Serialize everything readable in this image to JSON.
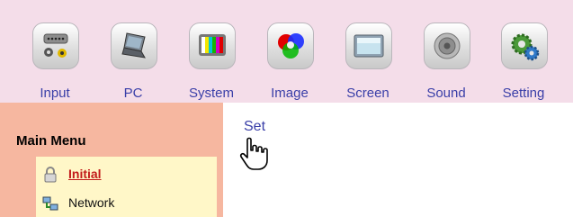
{
  "toolbar": {
    "items": [
      {
        "label": "Input",
        "icon": "input-connector-icon"
      },
      {
        "label": "PC",
        "icon": "laptop-icon"
      },
      {
        "label": "System",
        "icon": "color-bars-icon"
      },
      {
        "label": "Image",
        "icon": "rgb-balls-icon"
      },
      {
        "label": "Screen",
        "icon": "screen-icon"
      },
      {
        "label": "Sound",
        "icon": "speaker-icon"
      },
      {
        "label": "Setting",
        "icon": "gears-icon"
      }
    ]
  },
  "sidebar": {
    "title": "Main Menu",
    "items": [
      {
        "label": "Initial",
        "icon": "lock-icon",
        "active": true
      },
      {
        "label": "Network",
        "icon": "network-icon",
        "active": false
      }
    ]
  },
  "main": {
    "link_label": "Set"
  },
  "colors": {
    "toolbar_bg": "#f4dde9",
    "sidebar_bg": "#f6b7a0",
    "menu_bg": "#fff7c8",
    "link": "#3a3fa8",
    "active_item": "#c21a1a"
  }
}
